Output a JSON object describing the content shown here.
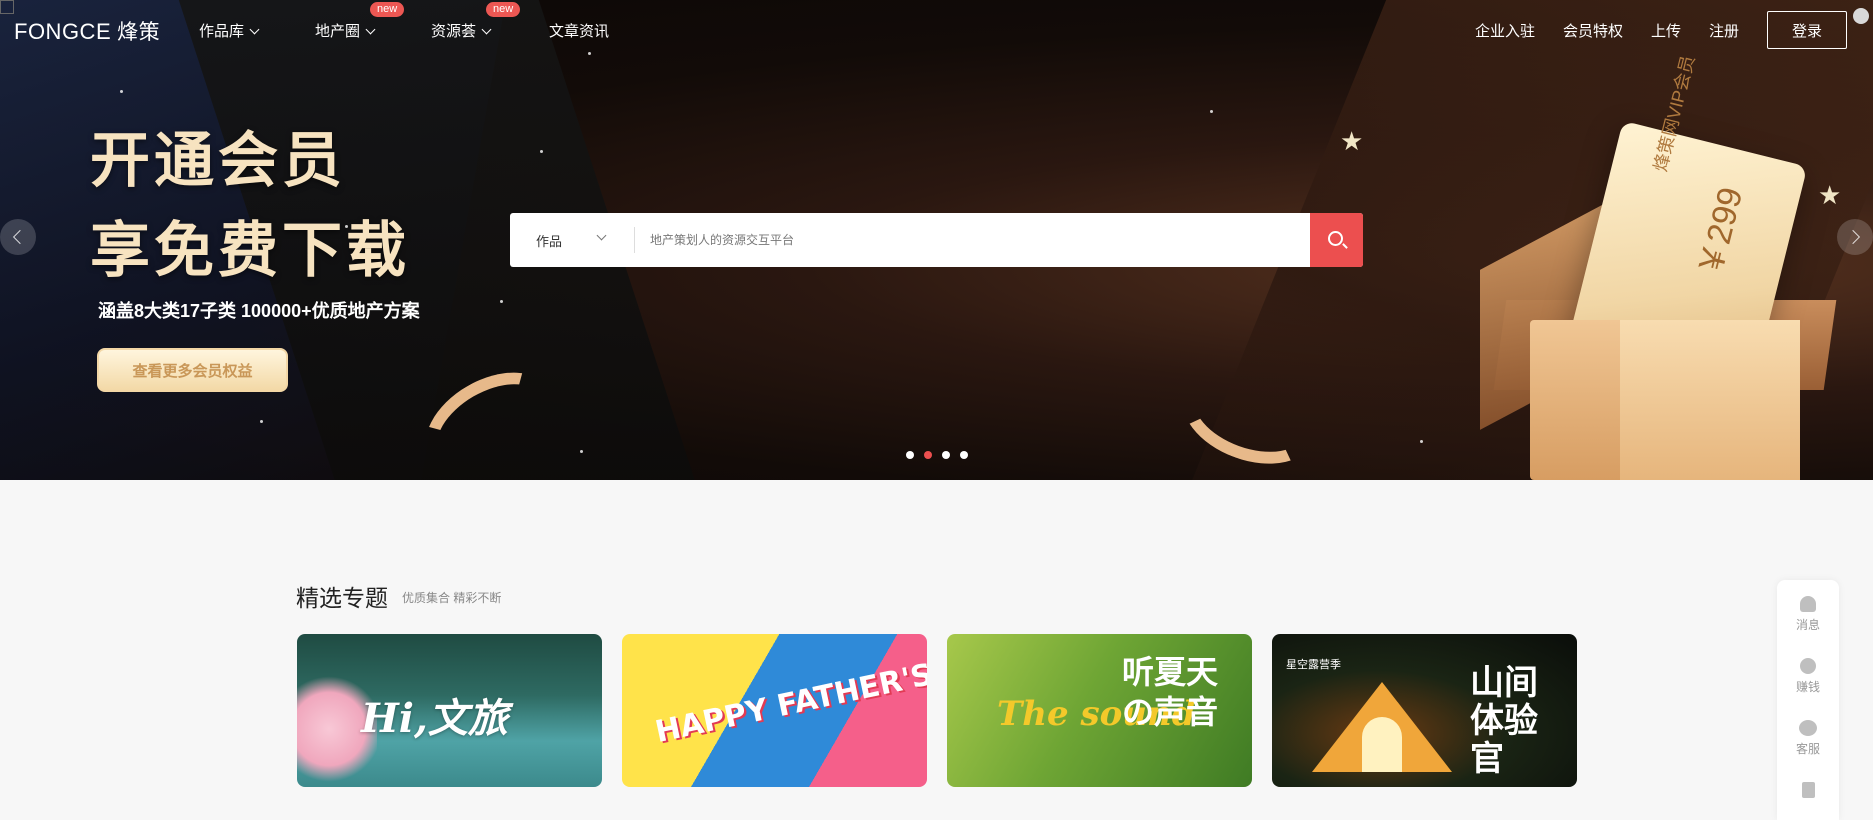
{
  "nav": {
    "logo_en": "FONGCE",
    "logo_cn": "烽策",
    "items": [
      {
        "label": "作品库",
        "has_dropdown": true,
        "badge": ""
      },
      {
        "label": "地产圈",
        "has_dropdown": true,
        "badge": "new"
      },
      {
        "label": "资源荟",
        "has_dropdown": true,
        "badge": "new"
      },
      {
        "label": "文章资讯",
        "has_dropdown": false,
        "badge": ""
      }
    ],
    "right": [
      "企业入驻",
      "会员特权",
      "上传",
      "注册"
    ],
    "login": "登录"
  },
  "hero": {
    "headline1": "开通会员",
    "headline2": "享免费下载",
    "subline": "涵盖8大类17子类 100000+优质地产方案",
    "cta": "查看更多会员权益",
    "card_vip": "烽策网VIP会员",
    "card_price": "￥299",
    "slides_count": 4,
    "active_slide": 2
  },
  "search": {
    "category": "作品",
    "placeholder": "地产策划人的资源交互平台"
  },
  "section": {
    "title": "精选专题",
    "subtitle": "优质集合 精彩不断",
    "topics": [
      {
        "text": "Hi,文旅"
      },
      {
        "text": "HAPPY FATHER'S DAY"
      },
      {
        "text_en": "The sound",
        "text_cn": "听夏天の声音"
      },
      {
        "text": "山间体验官",
        "tag": "星空露营季"
      }
    ]
  },
  "float_bar": {
    "items": [
      {
        "label": "消息",
        "icon": "bell-icon"
      },
      {
        "label": "赚钱",
        "icon": "coins-icon"
      },
      {
        "label": "客服",
        "icon": "chat-icon"
      },
      {
        "label": "",
        "icon": "document-icon"
      }
    ]
  },
  "colors": {
    "accent_red": "#ec4f4f",
    "gold_text": "#f7e3c0",
    "badge": "#ec5753"
  }
}
